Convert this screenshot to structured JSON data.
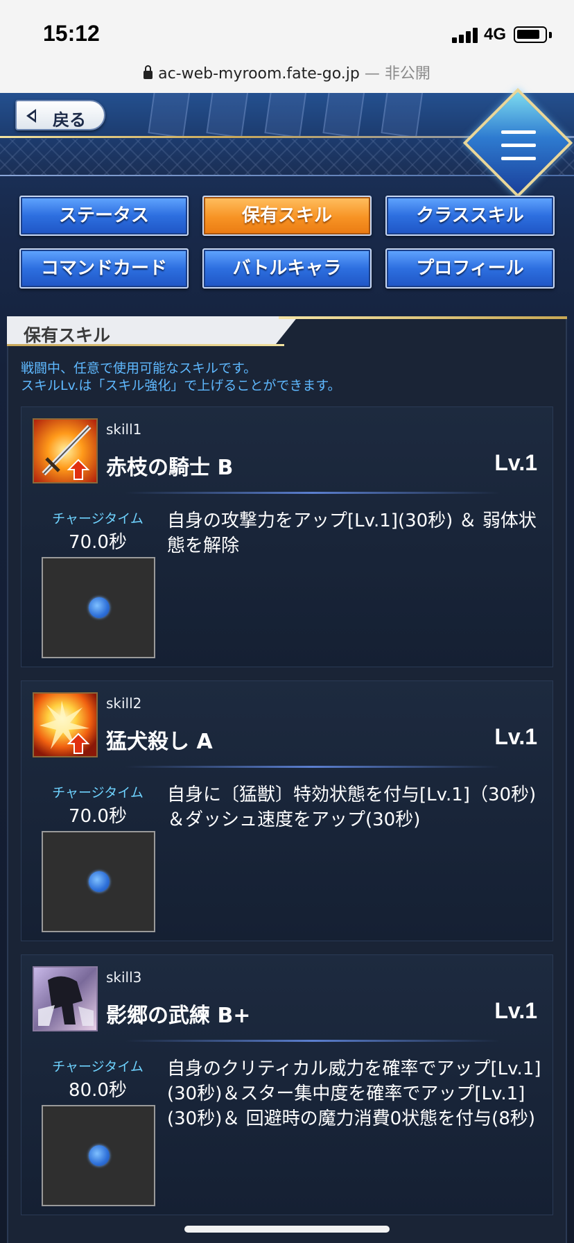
{
  "status_bar": {
    "time": "15:12",
    "network": "4G"
  },
  "browser": {
    "url": "ac-web-myroom.fate-go.jp",
    "separator": " — ",
    "privacy": "非公開"
  },
  "nav": {
    "back_label": "戻る"
  },
  "tabs": [
    {
      "label": "ステータス",
      "active": false
    },
    {
      "label": "保有スキル",
      "active": true
    },
    {
      "label": "クラススキル",
      "active": false
    },
    {
      "label": "コマンドカード",
      "active": false
    },
    {
      "label": "バトルキャラ",
      "active": false
    },
    {
      "label": "プロフィール",
      "active": false
    }
  ],
  "panel": {
    "title": "保有スキル",
    "desc_line1": "戦闘中、任意で使用可能なスキルです。",
    "desc_line2": "スキルLv.は「スキル強化」で上げることができます。"
  },
  "skills": [
    {
      "id": "skill1",
      "name": "赤枝の騎士 B",
      "level": "Lv.1",
      "charge_label": "チャージタイム",
      "charge_value": "70.0秒",
      "description": "自身の攻撃力をアップ[Lv.1](30秒) ＆ 弱体状態を解除",
      "icon": "sword-attack-up-icon"
    },
    {
      "id": "skill2",
      "name": "猛犬殺し A",
      "level": "Lv.1",
      "charge_label": "チャージタイム",
      "charge_value": "70.0秒",
      "description": "自身に〔猛獣〕特効状態を付与[Lv.1]（30秒)＆ダッシュ速度をアップ(30秒)",
      "icon": "burst-attack-up-icon"
    },
    {
      "id": "skill3",
      "name": "影郷の武練 B+",
      "level": "Lv.1",
      "charge_label": "チャージタイム",
      "charge_value": "80.0秒",
      "description": "自身のクリティカル威力を確率でアップ[Lv.1](30秒)＆スター集中度を確率でアップ[Lv.1](30秒)＆ 回避時の魔力消費0状態を付与(8秒)",
      "icon": "shadow-figure-icon"
    }
  ],
  "colors": {
    "accent_orange": "#f79324",
    "tab_blue": "#2d6fe0",
    "desc_blue": "#5fb9ff",
    "charge_cyan": "#6fd3ff"
  }
}
